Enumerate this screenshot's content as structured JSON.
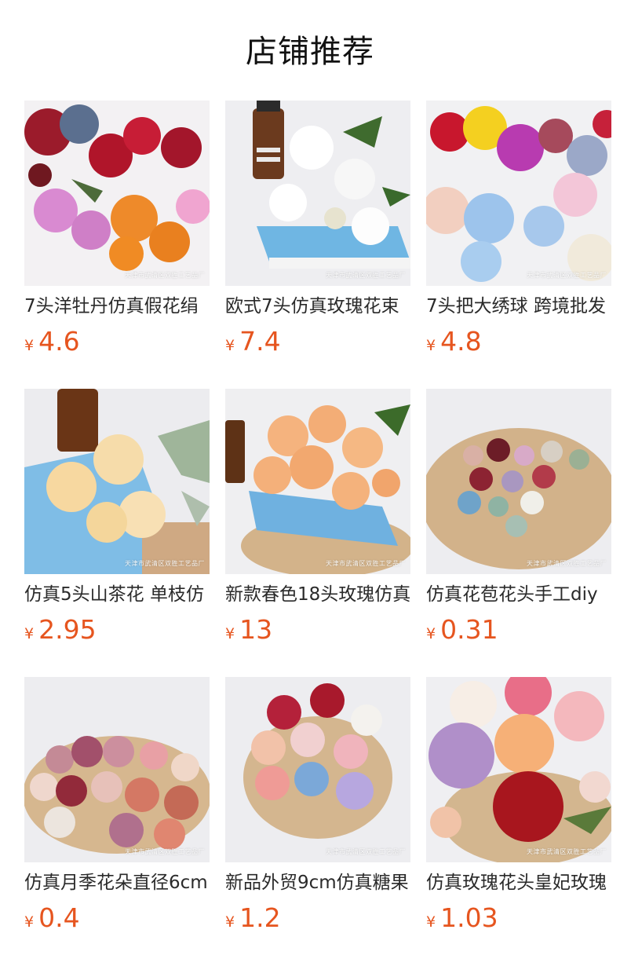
{
  "section_title": "店铺推荐",
  "currency": "¥",
  "watermark": "天津市武清区双胜工艺品厂",
  "products": [
    {
      "name": "7头洋牡丹仿真假花绢",
      "price": "4.6",
      "image": "peony-bouquet-image"
    },
    {
      "name": "欧式7头仿真玫瑰花束",
      "price": "7.4",
      "image": "white-rose-bouquet-image"
    },
    {
      "name": "7头把大绣球 跨境批发",
      "price": "4.8",
      "image": "hydrangea-image"
    },
    {
      "name": "仿真5头山茶花 单枝仿",
      "price": "2.95",
      "image": "champagne-camellia-image"
    },
    {
      "name": "新款春色18头玫瑰仿真",
      "price": "13",
      "image": "peach-rose-bouquet-image"
    },
    {
      "name": "仿真花苞花头手工diy",
      "price": "0.31",
      "image": "flower-bud-heads-image"
    },
    {
      "name": "仿真月季花朵直径6cm",
      "price": "0.4",
      "image": "rose-blossom-heads-image"
    },
    {
      "name": "新品外贸9cm仿真糖果",
      "price": "1.2",
      "image": "candy-rose-heads-image"
    },
    {
      "name": "仿真玫瑰花头皇妃玫瑰",
      "price": "1.03",
      "image": "princess-rose-heads-image"
    }
  ]
}
